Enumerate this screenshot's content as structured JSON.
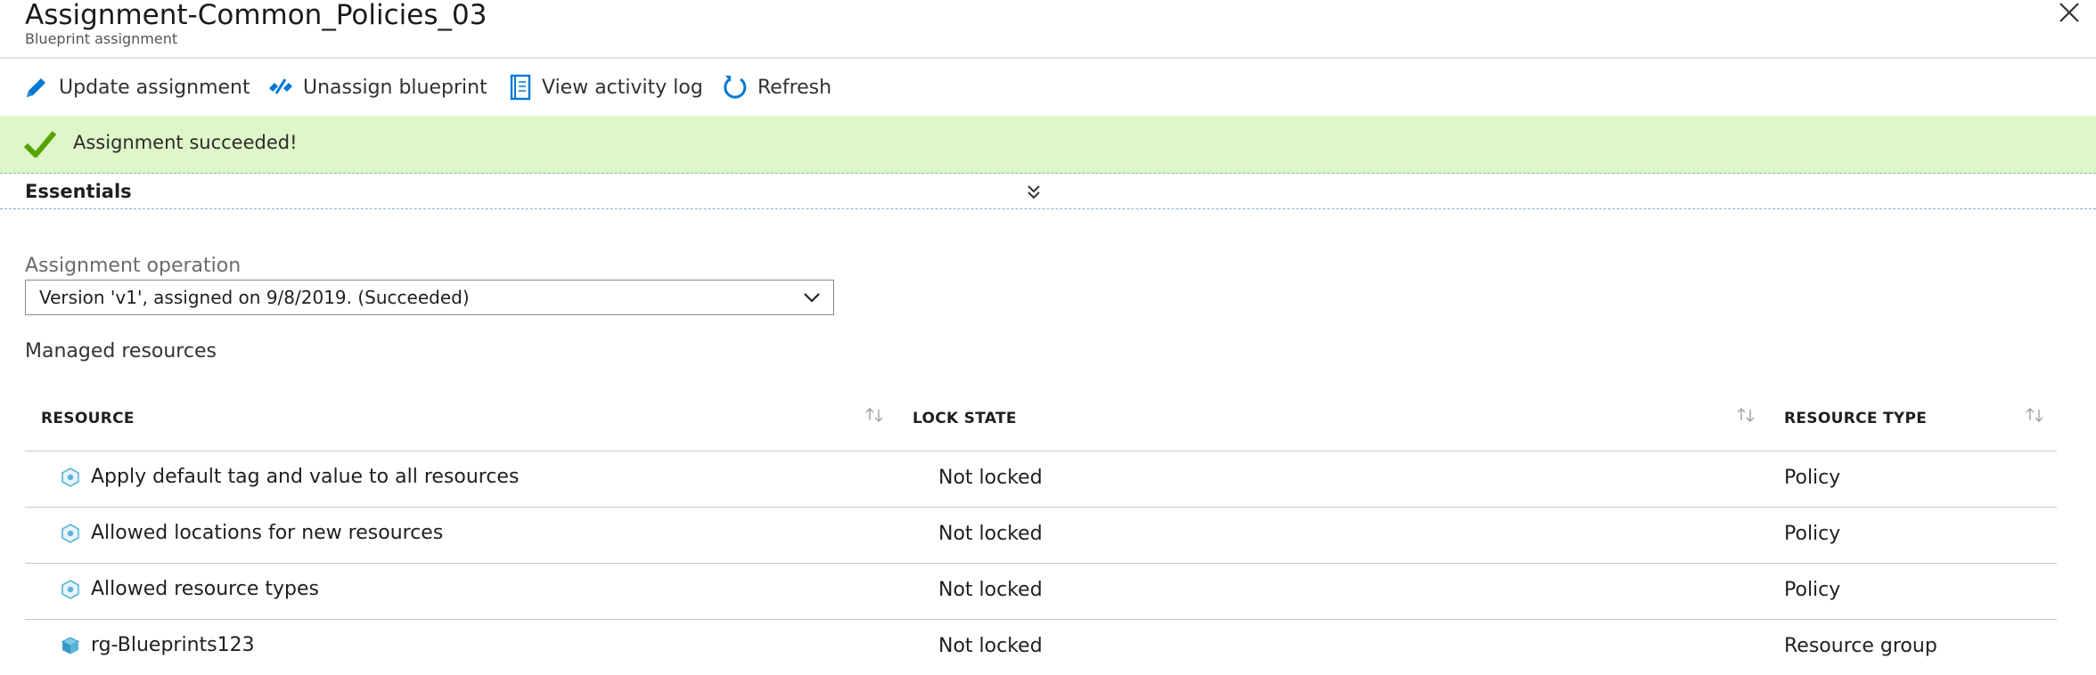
{
  "header": {
    "title": "Assignment-Common_Policies_03",
    "subtitle": "Blueprint assignment"
  },
  "toolbar": {
    "update_label": "Update assignment",
    "unassign_label": "Unassign blueprint",
    "activity_label": "View activity log",
    "refresh_label": "Refresh"
  },
  "banner": {
    "message": "Assignment succeeded!",
    "color": "#dff6c9"
  },
  "essentials": {
    "label": "Essentials"
  },
  "operation": {
    "label": "Assignment operation",
    "selected": "Version 'v1', assigned on 9/8/2019. (Succeeded)"
  },
  "managed": {
    "label": "Managed resources",
    "columns": [
      "RESOURCE",
      "LOCK STATE",
      "RESOURCE TYPE"
    ],
    "rows": [
      {
        "icon": "policy-icon",
        "resource": "Apply default tag and value to all resources",
        "lock_state": "Not locked",
        "type": "Policy"
      },
      {
        "icon": "policy-icon",
        "resource": "Allowed locations for new resources",
        "lock_state": "Not locked",
        "type": "Policy"
      },
      {
        "icon": "policy-icon",
        "resource": "Allowed resource types",
        "lock_state": "Not locked",
        "type": "Policy"
      },
      {
        "icon": "resource-group-icon",
        "resource": "rg-Blueprints123",
        "lock_state": "Not locked",
        "type": "Resource group"
      }
    ]
  },
  "colors": {
    "accent": "#0078d4",
    "success": "#57a300"
  }
}
